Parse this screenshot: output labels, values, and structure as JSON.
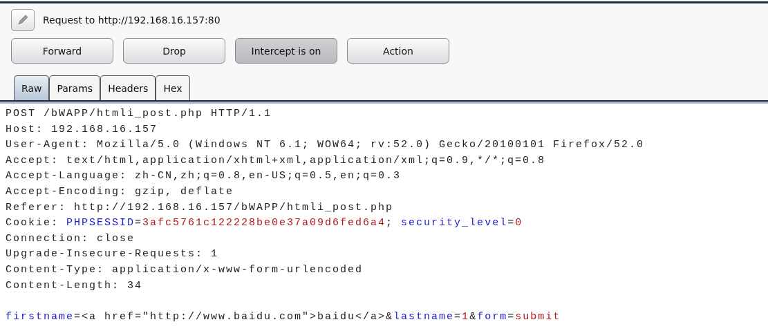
{
  "request_label": "Request to http://192.168.16.157:80",
  "buttons": [
    {
      "label": "Forward",
      "selected": false
    },
    {
      "label": "Drop",
      "selected": false
    },
    {
      "label": "Intercept is on",
      "selected": true
    },
    {
      "label": "Action",
      "selected": false
    }
  ],
  "tabs": [
    {
      "label": "Raw",
      "selected": true
    },
    {
      "label": "Params",
      "selected": false
    },
    {
      "label": "Headers",
      "selected": false
    },
    {
      "label": "Hex",
      "selected": false
    }
  ],
  "headers": [
    [
      {
        "kind": "plain",
        "text": "POST /bWAPP/htmli_post.php HTTP/1.1"
      }
    ],
    [
      {
        "kind": "plain",
        "text": "Host: 192.168.16.157"
      }
    ],
    [
      {
        "kind": "plain",
        "text": "User-Agent: Mozilla/5.0 (Windows NT 6.1; WOW64; rv:52.0) Gecko/20100101 Firefox/52.0"
      }
    ],
    [
      {
        "kind": "plain",
        "text": "Accept: text/html,application/xhtml+xml,application/xml;q=0.9,*/*;q=0.8"
      }
    ],
    [
      {
        "kind": "plain",
        "text": "Accept-Language: zh-CN,zh;q=0.8,en-US;q=0.5,en;q=0.3"
      }
    ],
    [
      {
        "kind": "plain",
        "text": "Accept-Encoding: gzip, deflate"
      }
    ],
    [
      {
        "kind": "plain",
        "text": "Referer: http://192.168.16.157/bWAPP/htmli_post.php"
      }
    ],
    [
      {
        "kind": "plain",
        "text": "Cookie: "
      },
      {
        "kind": "name",
        "text": "PHPSESSID"
      },
      {
        "kind": "plain",
        "text": "="
      },
      {
        "kind": "value",
        "text": "3afc5761c122228be0e37a09d6fed6a4"
      },
      {
        "kind": "plain",
        "text": "; "
      },
      {
        "kind": "name",
        "text": "security_level"
      },
      {
        "kind": "plain",
        "text": "="
      },
      {
        "kind": "value",
        "text": "0"
      }
    ],
    [
      {
        "kind": "plain",
        "text": "Connection: close"
      }
    ],
    [
      {
        "kind": "plain",
        "text": "Upgrade-Insecure-Requests: 1"
      }
    ],
    [
      {
        "kind": "plain",
        "text": "Content-Type: application/x-www-form-urlencoded"
      }
    ],
    [
      {
        "kind": "plain",
        "text": "Content-Length: 34"
      }
    ]
  ],
  "body": [
    {
      "kind": "name",
      "text": "firstname"
    },
    {
      "kind": "plain",
      "text": "=<a href=\"http://www.baidu.com\">baidu</a>&"
    },
    {
      "kind": "name",
      "text": "lastname"
    },
    {
      "kind": "plain",
      "text": "="
    },
    {
      "kind": "value",
      "text": "1"
    },
    {
      "kind": "plain",
      "text": "&"
    },
    {
      "kind": "name",
      "text": "form"
    },
    {
      "kind": "plain",
      "text": "="
    },
    {
      "kind": "value",
      "text": "submit"
    }
  ]
}
